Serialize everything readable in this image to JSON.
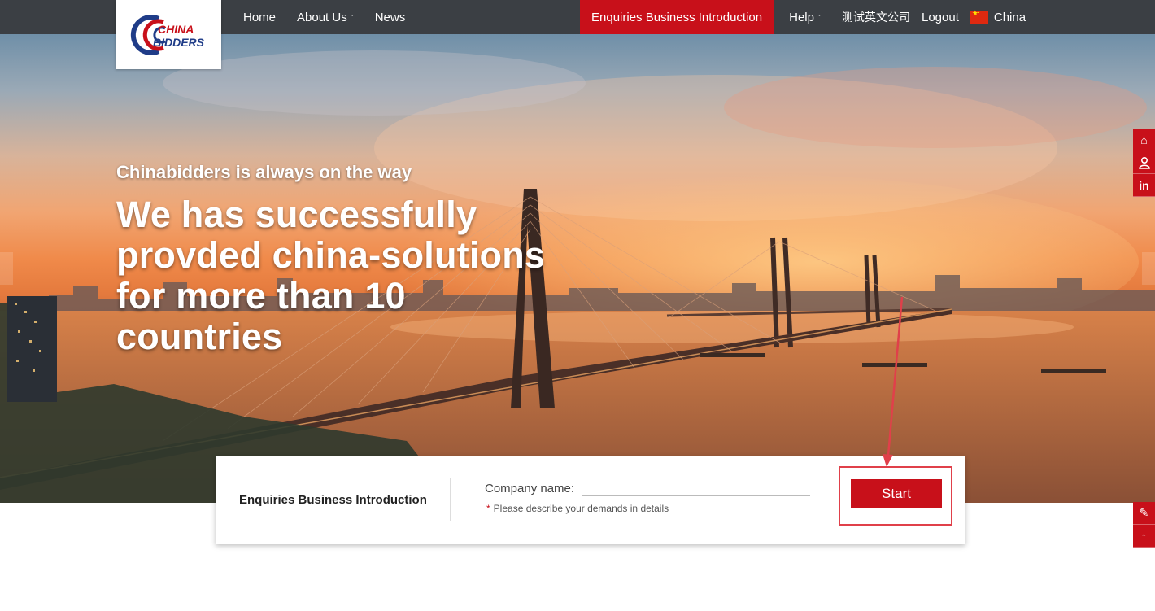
{
  "nav": {
    "left": [
      {
        "label": "Home",
        "dropdown": false
      },
      {
        "label": "About Us",
        "dropdown": true
      },
      {
        "label": "News",
        "dropdown": false
      }
    ],
    "active_label": "Enquiries Business Introduction",
    "help_label": "Help",
    "company_label": "测试英文公司",
    "logout_label": "Logout",
    "country_label": "China"
  },
  "logo": {
    "line1": "CHINA",
    "line2": "BIDDERS"
  },
  "hero": {
    "tagline": "Chinabidders is always on the way",
    "headline": "We has successfully provded china-solutions for more than 10 countries"
  },
  "side_tools": {
    "top": [
      {
        "name": "home-icon",
        "glyph": "⌂"
      },
      {
        "name": "user-icon",
        "glyph": "👤"
      },
      {
        "name": "linkedin-icon",
        "glyph": "in"
      }
    ],
    "bottom": [
      {
        "name": "edit-icon",
        "glyph": "✎"
      },
      {
        "name": "back-to-top-icon",
        "glyph": "↑"
      }
    ]
  },
  "enquiry": {
    "title": "Enquiries Business Introduction",
    "company_label": "Company name:",
    "company_value": "",
    "hint": "Please describe your demands in details",
    "hint_marker": "*",
    "start_label": "Start"
  },
  "colors": {
    "brand_red": "#c8101a",
    "nav_bg": "#3b3f44",
    "annotation": "#e0404a"
  }
}
